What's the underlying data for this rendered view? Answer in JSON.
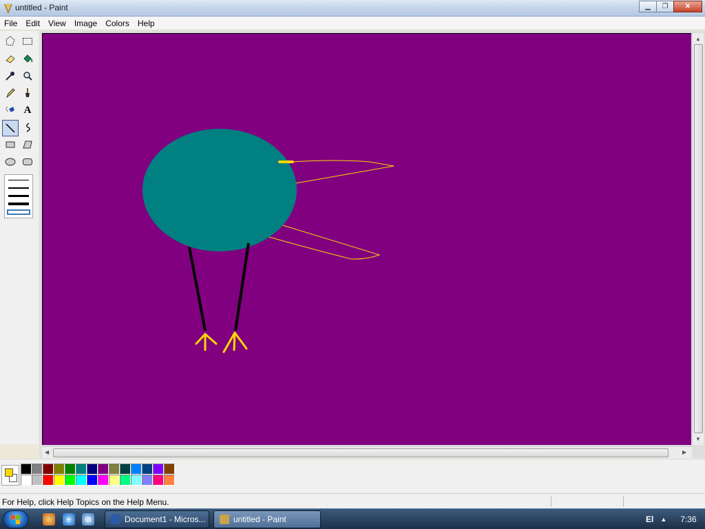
{
  "window": {
    "title": "untitled - Paint"
  },
  "menu": [
    "File",
    "Edit",
    "View",
    "Image",
    "Colors",
    "Help"
  ],
  "tools": [
    {
      "name": "free-form-select",
      "icon": "free-select-icon"
    },
    {
      "name": "select",
      "icon": "rect-select-icon"
    },
    {
      "name": "eraser",
      "icon": "eraser-icon"
    },
    {
      "name": "fill-with-color",
      "icon": "fill-bucket-icon"
    },
    {
      "name": "pick-color",
      "icon": "eyedropper-icon"
    },
    {
      "name": "magnifier",
      "icon": "magnifier-icon"
    },
    {
      "name": "pencil",
      "icon": "pencil-icon"
    },
    {
      "name": "brush",
      "icon": "brush-icon"
    },
    {
      "name": "airbrush",
      "icon": "airbrush-icon"
    },
    {
      "name": "text",
      "icon": "text-icon",
      "glyph": "A"
    },
    {
      "name": "line",
      "icon": "line-icon",
      "active": true
    },
    {
      "name": "curve",
      "icon": "curve-icon"
    },
    {
      "name": "rectangle",
      "icon": "rectangle-icon"
    },
    {
      "name": "polygon",
      "icon": "polygon-icon"
    },
    {
      "name": "ellipse",
      "icon": "ellipse-icon"
    },
    {
      "name": "rounded-rectangle",
      "icon": "rounded-rect-icon"
    }
  ],
  "canvas": {
    "background": "#800080",
    "body_color": "#008080",
    "outline_color": "#ffd700",
    "leg_color": "#000000"
  },
  "palette": {
    "foreground": "#ffd700",
    "background": "#ffffff",
    "top": [
      "#000000",
      "#808080",
      "#800000",
      "#808000",
      "#008000",
      "#008080",
      "#000080",
      "#800080",
      "#808040",
      "#004040",
      "#0080ff",
      "#004080",
      "#8000ff",
      "#804000"
    ],
    "bottom": [
      "#ffffff",
      "#c0c0c0",
      "#ff0000",
      "#ffff00",
      "#00ff00",
      "#00ffff",
      "#0000ff",
      "#ff00ff",
      "#ffff80",
      "#00ff80",
      "#80ffff",
      "#8080ff",
      "#ff0080",
      "#ff8040"
    ]
  },
  "status": {
    "message": "For Help, click Help Topics on the Help Menu."
  },
  "taskbar": {
    "buttons": [
      "Document1 - Micros...",
      "untitled - Paint"
    ],
    "language": "El",
    "time": "7:36"
  }
}
